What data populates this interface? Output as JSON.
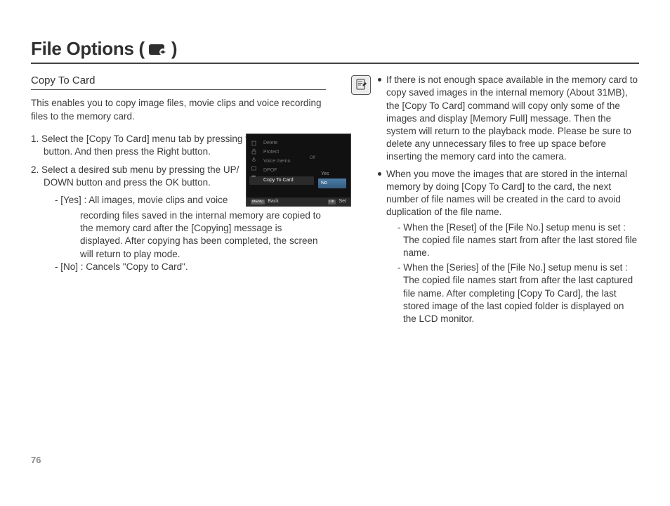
{
  "page": {
    "number": "76",
    "title_prefix": "File Options (",
    "title_suffix": ")"
  },
  "section": {
    "heading": "Copy To Card",
    "intro": "This enables you to copy image files, movie clips and voice recording files to the memory card."
  },
  "steps": [
    {
      "num": "1.",
      "text": "Select the [Copy To Card] menu tab by pressing the Up / Down button. And then press the Right button."
    },
    {
      "num": "2.",
      "text": "Select a desired sub menu by pressing the UP/ DOWN button and press the OK button."
    }
  ],
  "options": {
    "yes_label": "- [Yes] :",
    "yes_intro": "All images, movie clips and voice",
    "yes_cont": "recording files saved in the internal memory are copied to the memory card after the [Copying] message is displayed. After copying has been completed, the screen will return to play mode.",
    "no_label": "- [No]  :",
    "no_text": "Cancels \"Copy to Card\"."
  },
  "lcd": {
    "items": [
      "Delete",
      "Protect",
      "Voice memo",
      "DPOF",
      "Copy To Card"
    ],
    "voice_value": "Off",
    "submenu": {
      "yes": "Yes",
      "no": "No"
    },
    "bottom": {
      "back_key": "MENU",
      "back": "Back",
      "set_key": "OK",
      "set": "Set"
    }
  },
  "notes": [
    {
      "text": "If there is not enough space available in the memory card to copy saved images in the internal memory (About 31MB), the [Copy To Card] command will copy only some of the images and display [Memory Full] message. Then the system will return to the playback mode. Please be sure to delete any unnecessary files to free up space before inserting the memory card into the camera."
    },
    {
      "text": "When you move the images that are stored in the internal memory by doing [Copy To Card] to the card, the next number of file names will be created in the card to avoid duplication of the file name.",
      "sub": [
        "- When the [Reset] of the [File No.] setup menu is set : The copied file names start from after the last stored file name.",
        "- When the [Series] of the [File No.] setup menu is set : The copied file names start from after the last captured file name. After completing [Copy To Card], the last stored image of the last copied folder is displayed on the LCD monitor."
      ]
    }
  ]
}
